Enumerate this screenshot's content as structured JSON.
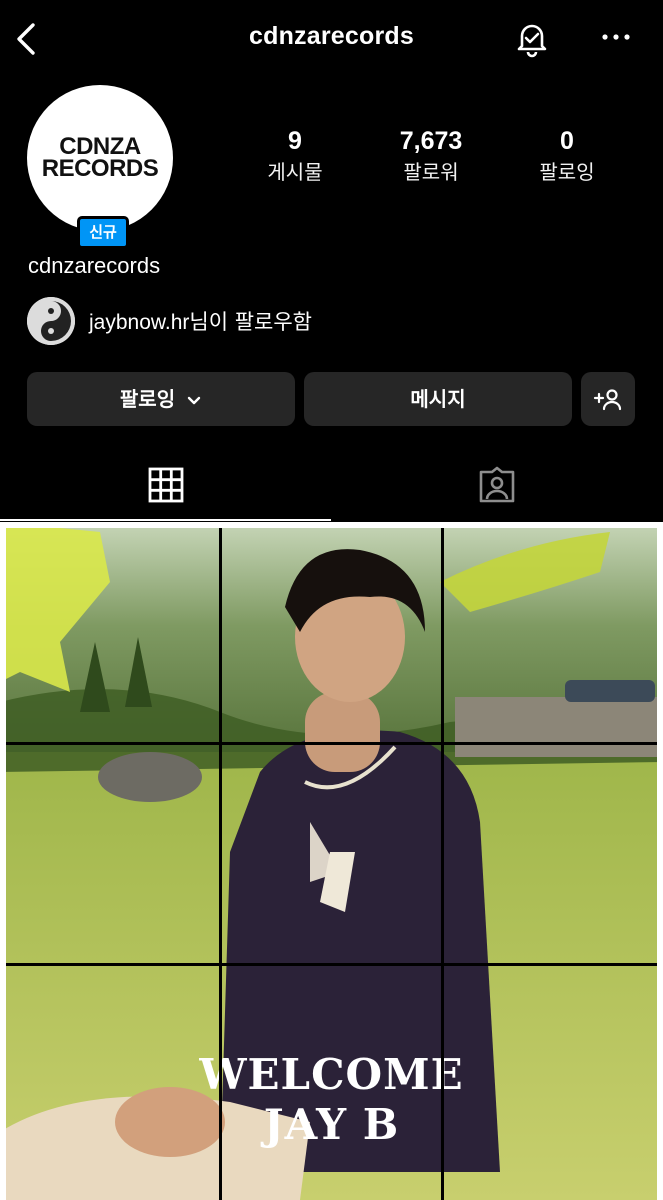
{
  "header": {
    "title": "cdnzarecords",
    "back_icon": "chevron-left-icon",
    "bell_icon": "bell-check-icon",
    "more_icon": "more-horizontal-icon"
  },
  "profile": {
    "avatar_line1": "CDNZA",
    "avatar_line2": "RECORDS",
    "badge": "신규",
    "username": "cdnzarecords"
  },
  "stats": [
    {
      "value": "9",
      "label": "게시물"
    },
    {
      "value": "7,673",
      "label": "팔로워"
    },
    {
      "value": "0",
      "label": "팔로잉"
    }
  ],
  "followed_by": {
    "user": "jaybnow.hr",
    "suffix": "님이 팔로우함"
  },
  "actions": {
    "following_label": "팔로잉",
    "message_label": "메시지"
  },
  "tabs": [
    {
      "name": "grid",
      "icon": "grid-icon",
      "active": true
    },
    {
      "name": "tagged",
      "icon": "tagged-person-icon",
      "active": false
    }
  ],
  "post": {
    "line1": "WELCOME",
    "line2": "JAY B"
  },
  "colors": {
    "background": "#000000",
    "button": "#262626",
    "badge": "#0095f6"
  }
}
